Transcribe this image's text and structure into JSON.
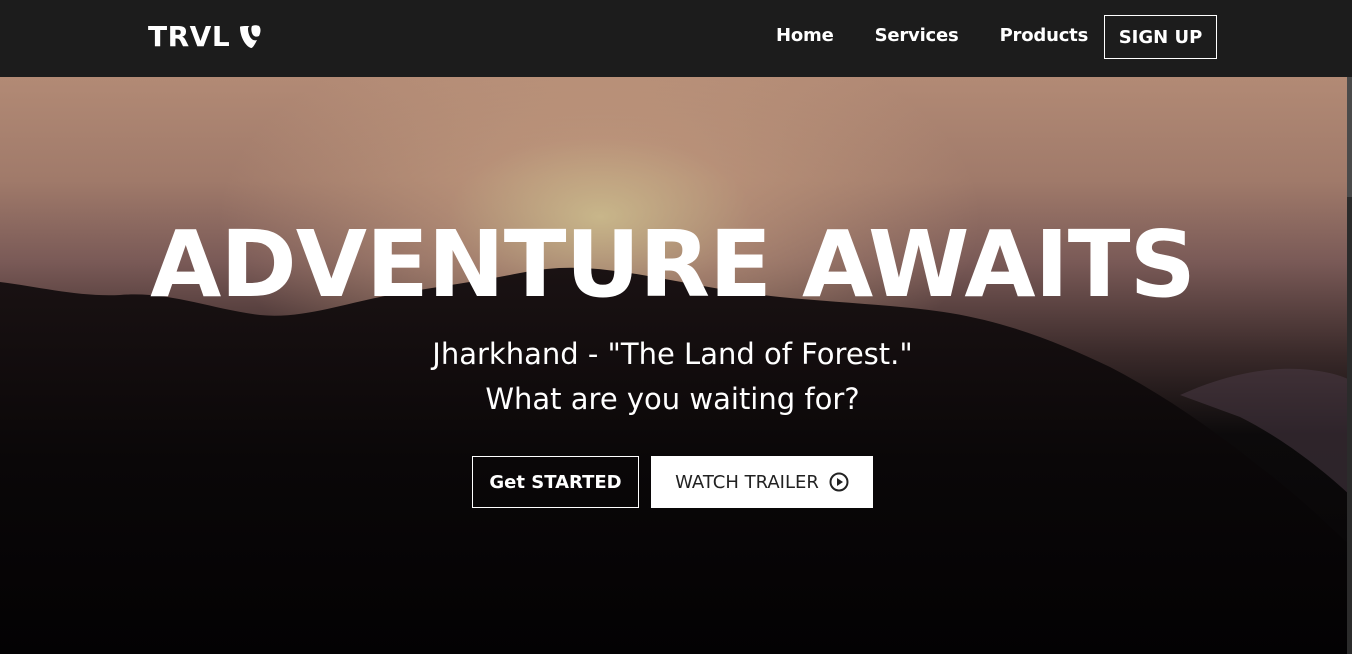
{
  "navbar": {
    "logo_text": "TRVL",
    "logo_icon": "typo3-icon",
    "links": [
      {
        "label": "Home"
      },
      {
        "label": "Services"
      },
      {
        "label": "Products"
      }
    ],
    "signup_label": "SIGN UP"
  },
  "hero": {
    "title": "ADVENTURE AWAITS",
    "subtitle_line1": "Jharkhand - \"The Land of Forest.\"",
    "subtitle_line2": "What are you waiting for?",
    "get_started_label": "Get STARTED",
    "watch_trailer_label": "WATCH TRAILER",
    "watch_trailer_icon": "play-circle-icon"
  },
  "colors": {
    "navbar_bg": "#1c1c1c",
    "text": "#ffffff",
    "trailer_btn_bg": "#ffffff"
  }
}
